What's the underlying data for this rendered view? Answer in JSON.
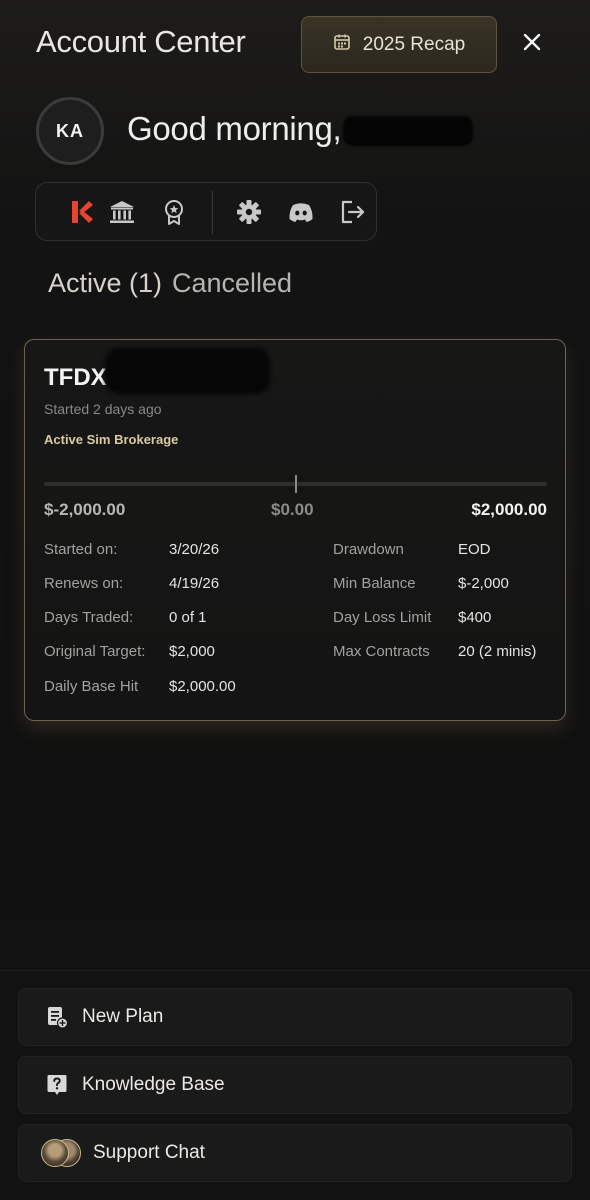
{
  "header": {
    "title": "Account Center",
    "recap_label": "2025 Recap"
  },
  "user": {
    "initials": "KA",
    "greeting": "Good morning,"
  },
  "iconbar": {
    "icons": [
      "brand-logo-icon",
      "bank-icon",
      "award-icon",
      "gear-icon",
      "discord-icon",
      "logout-icon"
    ]
  },
  "tabs": {
    "active": "Active (1)",
    "cancelled": "Cancelled"
  },
  "plan": {
    "name": "TFDX",
    "started_ago": "Started 2 days ago",
    "status": "Active Sim Brokerage",
    "range_low": "$-2,000.00",
    "range_mid": "$0.00",
    "range_high": "$2,000.00",
    "current_position_fraction": 0.5,
    "left_details": [
      {
        "label": "Started on:",
        "value": "3/20/26"
      },
      {
        "label": "Renews on:",
        "value": "4/19/26"
      },
      {
        "label": "Days Traded:",
        "value": "0 of 1"
      },
      {
        "label": "Original Target:",
        "value": "$2,000"
      },
      {
        "label": "Daily Base Hit",
        "value": "$2,000.00"
      }
    ],
    "right_details": [
      {
        "label": "Drawdown",
        "value": "EOD"
      },
      {
        "label": "Min Balance",
        "value": "$-2,000"
      },
      {
        "label": "Day Loss Limit",
        "value": "$400"
      },
      {
        "label": "Max Contracts",
        "value": "20 (2 minis)"
      }
    ]
  },
  "actions": {
    "new_plan": "New Plan",
    "knowledge_base": "Knowledge Base",
    "support_chat": "Support Chat"
  },
  "colors": {
    "accent_gold": "#d9c9a3",
    "brand_red": "#e8432e",
    "background": "#121212"
  }
}
